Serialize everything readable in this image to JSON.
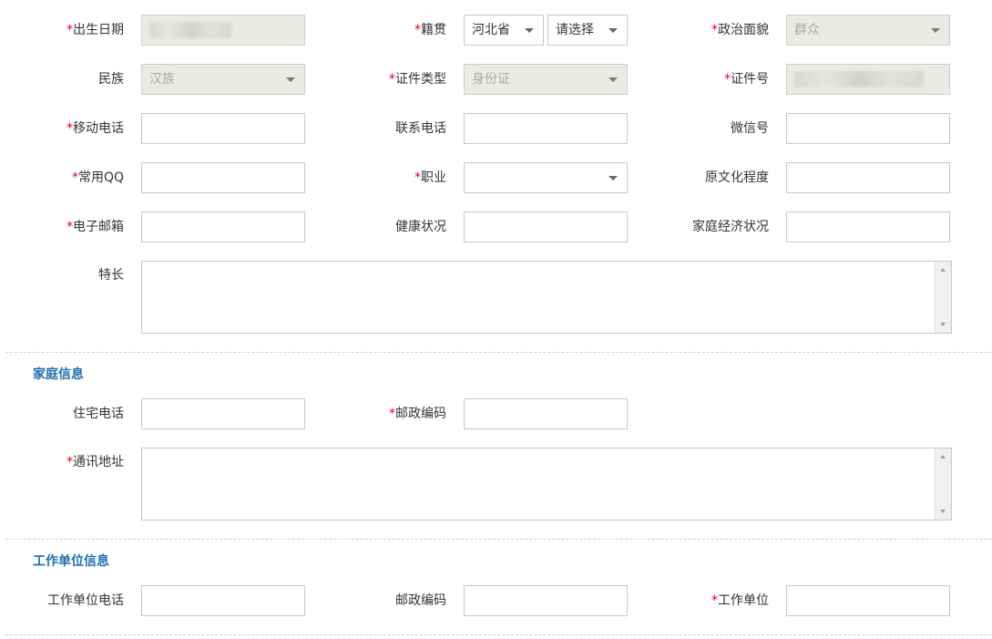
{
  "row1": {
    "birth_label": "出生日期",
    "native_label": "籍贯",
    "province_value": "河北省",
    "city_value": "请选择",
    "political_label": "政治面貌",
    "political_value": "群众"
  },
  "row2": {
    "ethnic_label": "民族",
    "ethnic_value": "汉族",
    "idtype_label": "证件类型",
    "idtype_value": "身份证",
    "idno_label": "证件号"
  },
  "row3": {
    "mobile_label": "移动电话",
    "phone_label": "联系电话",
    "wechat_label": "微信号"
  },
  "row4": {
    "qq_label": "常用QQ",
    "job_label": "职业",
    "edu_label": "原文化程度"
  },
  "row5": {
    "email_label": "电子邮箱",
    "health_label": "健康状况",
    "economy_label": "家庭经济状况"
  },
  "specialty_label": "特长",
  "family": {
    "title": "家庭信息",
    "home_phone_label": "住宅电话",
    "zip_label": "邮政编码",
    "address_label": "通讯地址"
  },
  "work": {
    "title": "工作单位信息",
    "phone_label": "工作单位电话",
    "zip_label": "邮政编码",
    "unit_label": "工作单位"
  }
}
